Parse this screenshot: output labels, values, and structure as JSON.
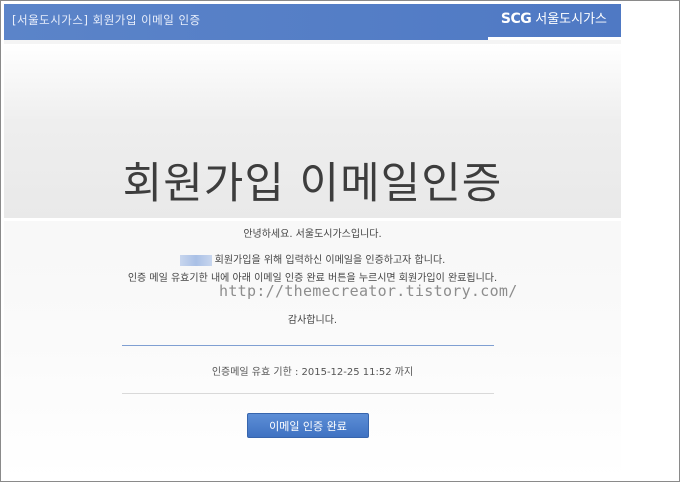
{
  "header": {
    "title": "[서울도시가스] 회원가입 이메일 인증",
    "logo_mark": "SCG",
    "logo_text": "서울도시가스"
  },
  "banner": {
    "headline": "회원가입 이메일인증"
  },
  "message": {
    "greeting": "안녕하세요. 서울도시가스입니다.",
    "line1": "회원가입을 위해 입력하신 이메일을 인증하고자 합니다.",
    "line2": "인증 메일 유효기한 내에 아래 이메일 인증 완료 버튼을 누르시면 회원가입이 완료됩니다.",
    "watermark": "http://themecreator.tistory.com/",
    "thanks": "감사합니다."
  },
  "expiry": {
    "text": "인증메일 유효 기한 : 2015-12-25 11:52 까지"
  },
  "button": {
    "label": "이메일 인증 완료"
  },
  "colors": {
    "header": "#5b84c9",
    "button": "#4a7ccb"
  }
}
